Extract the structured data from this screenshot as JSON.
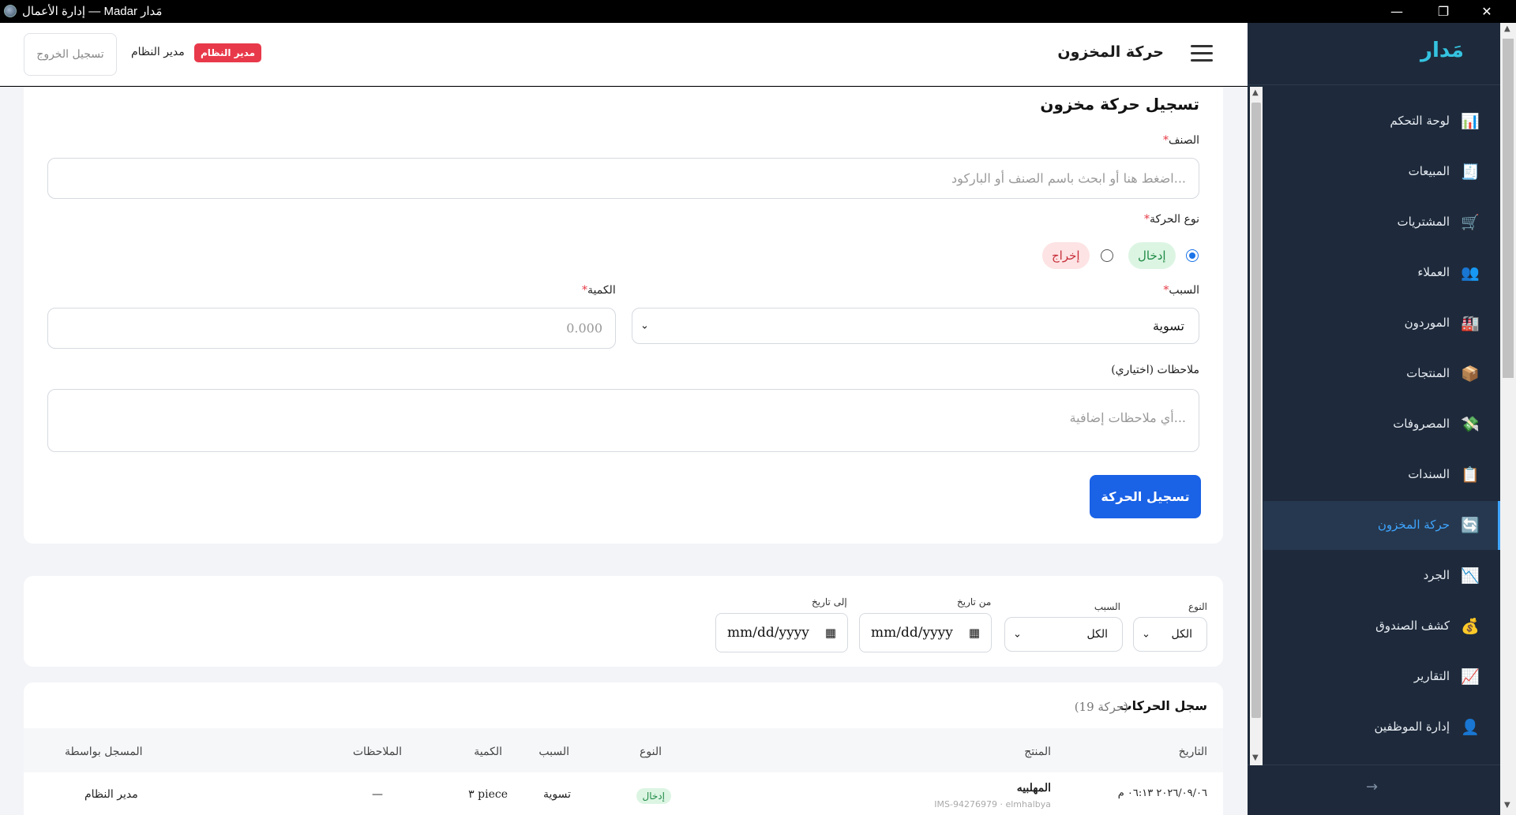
{
  "window": {
    "title": "إدارة الأعمال — Madar مَدار",
    "controls": {
      "minimize": "—",
      "maximize": "❐",
      "close": "✕"
    }
  },
  "sidebar": {
    "brand": "مَدار",
    "items": [
      {
        "label": "لوحة التحكم",
        "icon": "bar-chart-icon",
        "glyph": "📊"
      },
      {
        "label": "المبيعات",
        "icon": "receipt-icon",
        "glyph": "🧾"
      },
      {
        "label": "المشتريات",
        "icon": "shopping-cart-icon",
        "glyph": "🛒"
      },
      {
        "label": "العملاء",
        "icon": "users-icon",
        "glyph": "👥"
      },
      {
        "label": "الموردون",
        "icon": "factory-icon",
        "glyph": "🏭"
      },
      {
        "label": "المنتجات",
        "icon": "package-icon",
        "glyph": "📦"
      },
      {
        "label": "المصروفات",
        "icon": "money-wings-icon",
        "glyph": "💸"
      },
      {
        "label": "السندات",
        "icon": "clipboard-icon",
        "glyph": "📋"
      },
      {
        "label": "حركة المخزون",
        "icon": "refresh-icon",
        "glyph": "🔄",
        "active": true
      },
      {
        "label": "الجرد",
        "icon": "chart-down-icon",
        "glyph": "📉"
      },
      {
        "label": "كشف الصندوق",
        "icon": "money-bag-icon",
        "glyph": "💰"
      },
      {
        "label": "التقارير",
        "icon": "chart-up-icon",
        "glyph": "📈"
      },
      {
        "label": "إدارة الموظفين",
        "icon": "user-icon",
        "glyph": "👤"
      }
    ],
    "collapse_glyph": "→"
  },
  "header": {
    "title": "حركة المخزون",
    "logout_label": "تسجيل الخروج",
    "user_name": "مدير النظام",
    "role_badge": "مدير النظام"
  },
  "form": {
    "heading": "تسجيل حركة مخزون",
    "item_label": "الصنف",
    "item_placeholder": "اضغط هنا أو ابحث باسم الصنف أو الباركود...",
    "movement_type_label": "نوع الحركة",
    "type_in": "إدخال",
    "type_out": "إخراج",
    "reason_label": "السبب",
    "reason_value": "تسوية",
    "quantity_label": "الكمية",
    "quantity_placeholder": "0.000",
    "notes_label": "ملاحظات (اختياري)",
    "notes_placeholder": "أي ملاحظات إضافية...",
    "submit_label": "تسجيل الحركة",
    "required_mark": "*"
  },
  "filters": {
    "type_label": "النوع",
    "type_value": "الكل",
    "reason_label": "السبب",
    "reason_value": "الكل",
    "from_label": "من تاريخ",
    "from_value": "mm/dd/yyyy",
    "to_label": "إلى تاريخ",
    "to_value": "mm/dd/yyyy"
  },
  "table": {
    "title": "سجل الحركات",
    "count": "(19 حركة)",
    "columns": [
      "التاريخ",
      "المنتج",
      "النوع",
      "السبب",
      "الكمية",
      "الملاحظات",
      "المسجل بواسطة"
    ],
    "rows": [
      {
        "date": "٢٠٢٦/٠٩/٠٦ ٠٦:١٣ م",
        "product": "المهلبيه",
        "product_meta": "IMS-94276979 · elmhalbya",
        "type": "إدخال",
        "reason": "تسوية",
        "quantity": "٣ piece",
        "notes": "—",
        "by": "مدير النظام"
      }
    ]
  },
  "colors": {
    "sidebar_bg": "#1e2a3b",
    "brand": "#35c3e0",
    "active": "#3ea5ff",
    "primary_button": "#1a62e6",
    "danger_badge": "#e8394a",
    "in_pill_bg": "#dcf5e3",
    "out_pill_bg": "#fde3e4"
  }
}
